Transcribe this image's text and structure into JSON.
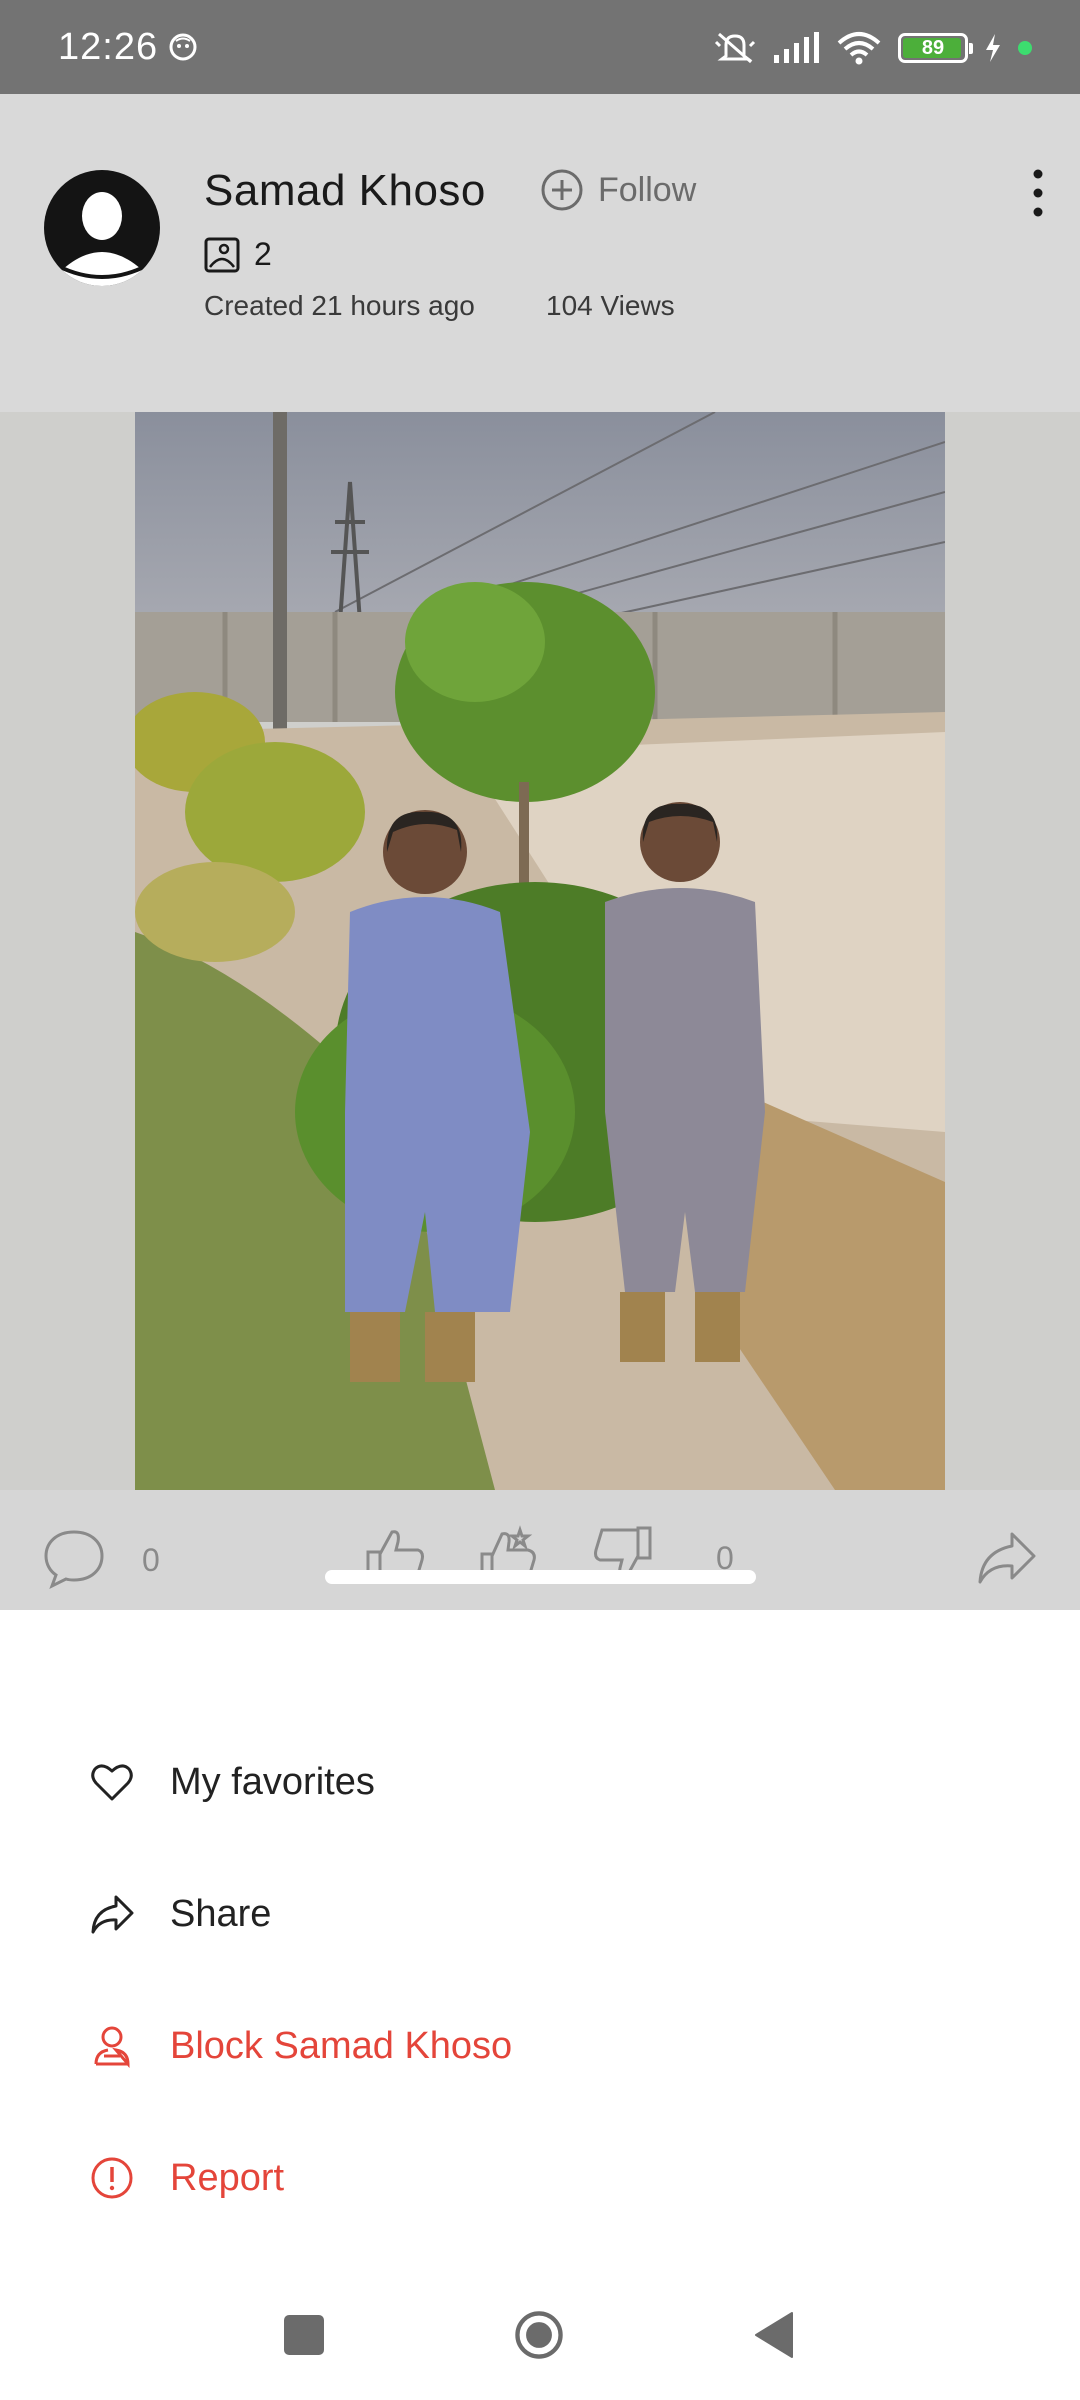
{
  "status_bar": {
    "time": "12:26",
    "battery_level": "89",
    "battery_fraction": 0.89,
    "icons": [
      "notification-app-icon",
      "do-not-disturb-icon",
      "signal-icon",
      "wifi-icon",
      "battery-icon",
      "charging-icon"
    ]
  },
  "post": {
    "author_name": "Samad Khoso",
    "follow_label": "Follow",
    "photo_count": "2",
    "created": "Created 21 hours ago",
    "views": "104 Views",
    "comment_count": "0",
    "reaction_count": "0"
  },
  "sheet": {
    "items": [
      {
        "label": "My favorites",
        "icon": "heart-icon"
      },
      {
        "label": "Share",
        "icon": "share-icon"
      },
      {
        "label": "Block Samad Khoso",
        "icon": "block-user-icon"
      },
      {
        "label": "Report",
        "icon": "report-icon"
      }
    ]
  },
  "colors": {
    "status_bar_bg": "#737373",
    "dim_bg": "#d9d9d9",
    "danger": "#e4453a",
    "battery_green": "#4caf3a"
  }
}
